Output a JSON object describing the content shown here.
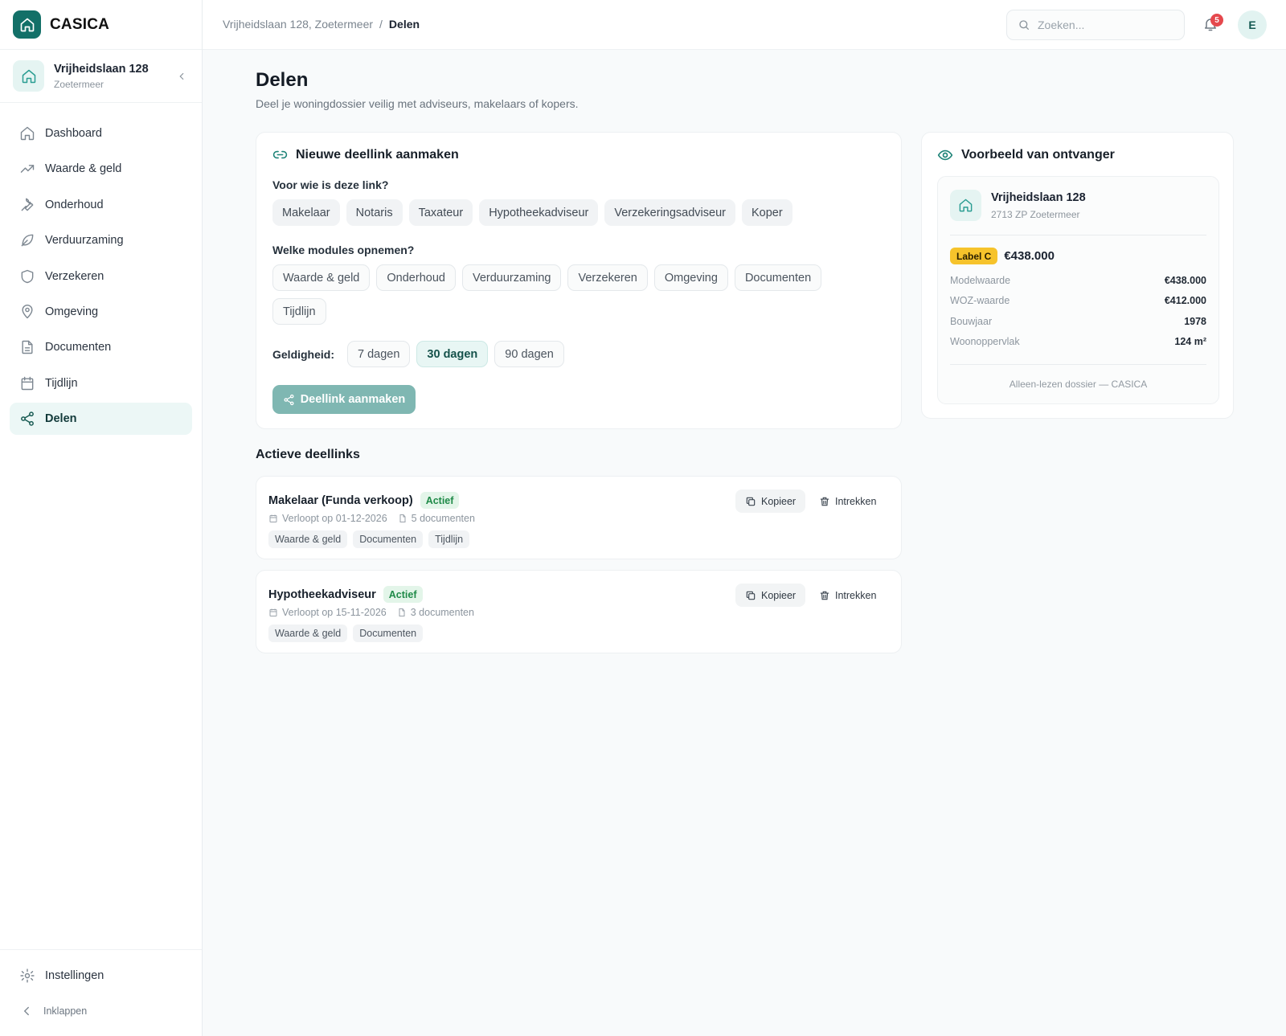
{
  "brand": {
    "name": "CASICA"
  },
  "property": {
    "name": "Vrijheidslaan 128",
    "city": "Zoetermeer"
  },
  "nav": [
    {
      "label": "Dashboard",
      "icon": "home-icon"
    },
    {
      "label": "Waarde & geld",
      "icon": "trending-up-icon"
    },
    {
      "label": "Onderhoud",
      "icon": "wrench-icon"
    },
    {
      "label": "Verduurzaming",
      "icon": "leaf-icon"
    },
    {
      "label": "Verzekeren",
      "icon": "shield-icon"
    },
    {
      "label": "Omgeving",
      "icon": "map-pin-icon"
    },
    {
      "label": "Documenten",
      "icon": "file-icon"
    },
    {
      "label": "Tijdlijn",
      "icon": "calendar-icon"
    },
    {
      "label": "Delen",
      "icon": "share-icon",
      "active": true
    }
  ],
  "sidebar_bottom": {
    "settings": "Instellingen",
    "collapse": "Inklappen"
  },
  "breadcrumb": {
    "parent": "Vrijheidslaan 128, Zoetermeer",
    "separator": "/",
    "current": "Delen"
  },
  "search": {
    "placeholder": "Zoeken..."
  },
  "notifications": {
    "count": "5"
  },
  "user": {
    "initial": "E"
  },
  "page": {
    "title": "Delen",
    "subtitle": "Deel je woningdossier veilig met adviseurs, makelaars of kopers."
  },
  "new_link": {
    "title": "Nieuwe deellink aanmaken",
    "recipient_label": "Voor wie is deze link?",
    "recipients": [
      "Makelaar",
      "Notaris",
      "Taxateur",
      "Hypotheekadviseur",
      "Verzekeringsadviseur",
      "Koper"
    ],
    "modules_label": "Welke modules opnemen?",
    "modules": [
      "Waarde & geld",
      "Onderhoud",
      "Verduurzaming",
      "Verzekeren",
      "Omgeving",
      "Documenten",
      "Tijdlijn"
    ],
    "validity_label": "Geldigheid:",
    "validity": [
      "7 dagen",
      "30 dagen",
      "90 dagen"
    ],
    "validity_selected": "30 dagen",
    "create_button": "Deellink aanmaken"
  },
  "active_links": {
    "title": "Actieve deellinks",
    "copy_label": "Kopieer",
    "revoke_label": "Intrekken",
    "items": [
      {
        "name": "Makelaar (Funda verkoop)",
        "status": "Actief",
        "expires": "Verloopt op 01-12-2026",
        "docs": "5 documenten",
        "tags": [
          "Waarde & geld",
          "Documenten",
          "Tijdlijn"
        ]
      },
      {
        "name": "Hypotheekadviseur",
        "status": "Actief",
        "expires": "Verloopt op 15-11-2026",
        "docs": "3 documenten",
        "tags": [
          "Waarde & geld",
          "Documenten"
        ]
      }
    ]
  },
  "preview": {
    "title": "Voorbeeld van ontvanger",
    "name": "Vrijheidslaan 128",
    "zip": "2713 ZP Zoetermeer",
    "energy_label": "Label C",
    "price": "€438.000",
    "rows": [
      {
        "k": "Modelwaarde",
        "v": "€438.000"
      },
      {
        "k": "WOZ-waarde",
        "v": "€412.000"
      },
      {
        "k": "Bouwjaar",
        "v": "1978"
      },
      {
        "k": "Woonoppervlak",
        "v": "124 m²"
      }
    ],
    "footer": "Alleen-lezen dossier — CASICA"
  },
  "colors": {
    "brand": "#137068",
    "accent_light": "#e8f6f4",
    "energy_c": "#f6c32b",
    "status_active": "#1f8a48",
    "notification": "#e5484d"
  }
}
